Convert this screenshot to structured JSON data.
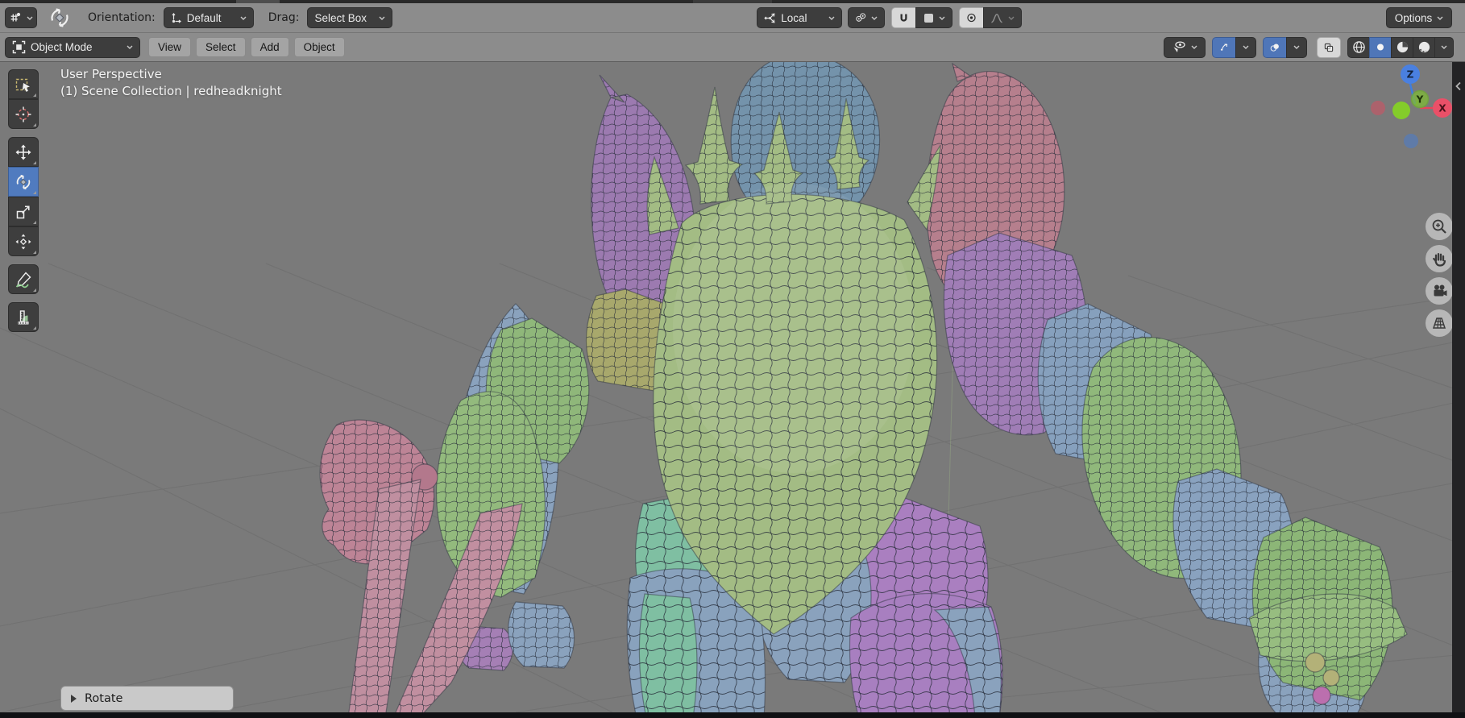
{
  "topbar": {
    "orientation_label": "Orientation:",
    "orientation_value": "Default",
    "drag_label": "Drag:",
    "drag_value": "Select Box",
    "transform_orientation_value": "Local",
    "options_label": "Options"
  },
  "header": {
    "mode_label": "Object Mode",
    "menus": [
      {
        "label": "View"
      },
      {
        "label": "Select"
      },
      {
        "label": "Add"
      },
      {
        "label": "Object"
      }
    ]
  },
  "toolbar": {
    "tools": [
      {
        "name": "select-box",
        "active": false
      },
      {
        "name": "cursor",
        "active": false
      },
      {
        "name": "move",
        "active": false
      },
      {
        "name": "rotate",
        "active": true
      },
      {
        "name": "scale",
        "active": false
      },
      {
        "name": "transform",
        "active": false
      },
      {
        "name": "annotate",
        "active": false
      },
      {
        "name": "measure",
        "active": false
      }
    ]
  },
  "viewport": {
    "perspective_label": "User Perspective",
    "collection_label": "(1) Scene Collection | redheadknight",
    "operator_panel_label": "Rotate",
    "axis_labels": {
      "x": "X",
      "y": "Y",
      "z": "Z"
    }
  },
  "icons": {
    "editor-type-icon": "3d-viewport-editor glyph",
    "active-tool-rotate-icon": "circular arrows around diamond",
    "orientation-axes-icon": "axis arrows from origin dot",
    "transform-orientation-icon": "three arrows from point",
    "pivot-point-icon": "two circles with dots",
    "magnet-icon": "snap magnet (enabled)",
    "snap-target-icon": "increment square swatch",
    "proportional-editing-icon": "circle with center dot (enabled)",
    "falloff-curve-icon": "bell curve (disabled)",
    "chevron-down-icon": "dropdown arrow",
    "object-mode-icon": "square with corner brackets",
    "visibility-filter-icon": "pointer with eye",
    "gizmo-toggle-icon": "curved arrow gizmo (on, blue)",
    "overlays-toggle-icon": "two overlapping circles (on, blue)",
    "xray-toggle-icon": "overlapping squares (on, light)",
    "wireframe-shading-icon": "wire globe",
    "solid-shading-icon": "solid sphere (active, blue)",
    "material-shading-icon": "sphere with checker quarter",
    "rendered-shading-icon": "shaded sphere",
    "select-box-tool-icon": "dashed box with cursor",
    "cursor-tool-icon": "3d cursor crosshair",
    "move-tool-icon": "four-way arrows",
    "rotate-tool-icon": "circular arrows with diamond",
    "scale-tool-icon": "box with diagonal arrow",
    "transform-tool-icon": "gizmo with four arrows",
    "annotate-tool-icon": "pencil with stroke",
    "measure-tool-icon": "ruler and protractor",
    "zoom-icon": "magnifier with plus",
    "pan-hand-icon": "open hand",
    "camera-view-icon": "movie camera",
    "ortho-grid-icon": "perspective grid plane",
    "collapse-arrow-icon": "left chevron",
    "expand-arrow-icon": "right-pointing triangle"
  },
  "colors": {
    "header_bg": "#8c8c8c",
    "button_bg": "#3d3d3d",
    "accent_blue": "#4f76b8",
    "toggle_on": "#d8d8d8",
    "viewport_bg": "#7a7a7a",
    "axis_x": "#e8455a",
    "axis_y": "#84cc2a",
    "axis_z": "#3f7de0",
    "model_green": "#a3bc84",
    "model_blue": "#8aa2bd",
    "model_purple": "#a07db6",
    "model_pink": "#b67f8d",
    "model_teal": "#7fbfa2",
    "model_olive": "#a8a86c",
    "model_helmet": "#7493ab"
  }
}
